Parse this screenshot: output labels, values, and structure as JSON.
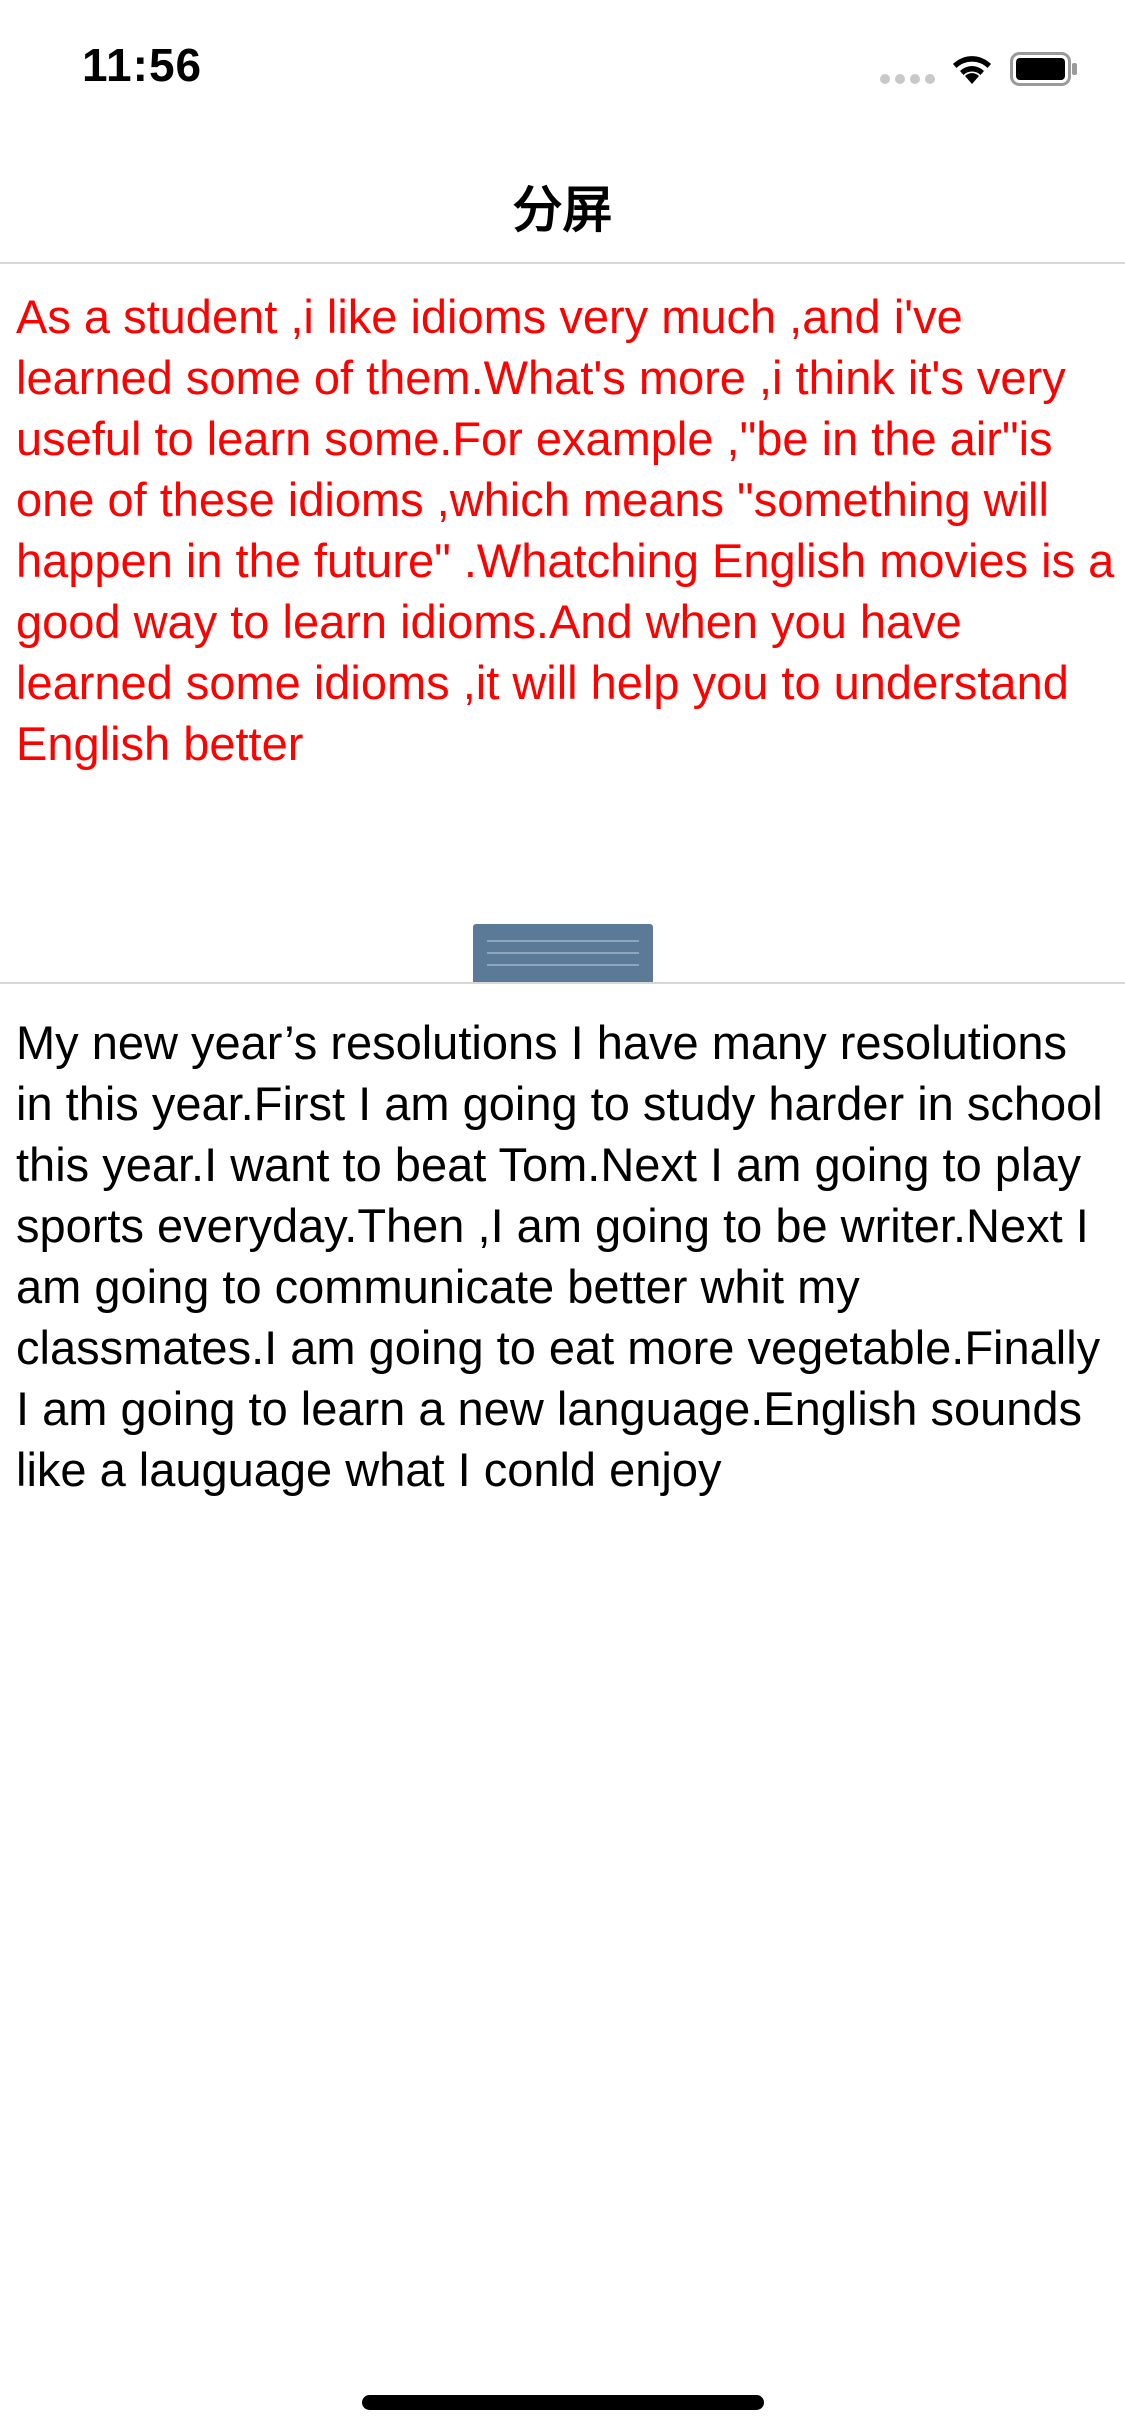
{
  "status_bar": {
    "time": "11:56",
    "signal_icon": "cellular-signal-icon",
    "wifi_icon": "wifi-icon",
    "battery_icon": "battery-icon"
  },
  "nav": {
    "title": "分屏"
  },
  "top_pane": {
    "text": "As a student ,i like idioms very much ,and i've learned some of them.What's more ,i think it's very useful to learn some.For example ,\"be in the air\"is one of these idioms ,which means \"something will happen in the future\" .Whatching English movies is a good way to learn idioms.And when you have learned some idioms ,it will help you to understand English better",
    "color": "#ff0000"
  },
  "divider": {
    "handle_icon": "drag-handle-icon",
    "color": "#5b7a98"
  },
  "bottom_pane": {
    "text": "My new year’s resolutions I have many resolutions in this year.First I am going to study harder in school this year.I want to beat Tom.Next I am going to play sports everyday.Then ,I am going to be writer.Next I am going to communicate better whit my classmates.I am going to eat more vegetable.Finally I am going to learn a new language.English sounds like a lauguage what I conld enjoy",
    "color": "#000000"
  }
}
